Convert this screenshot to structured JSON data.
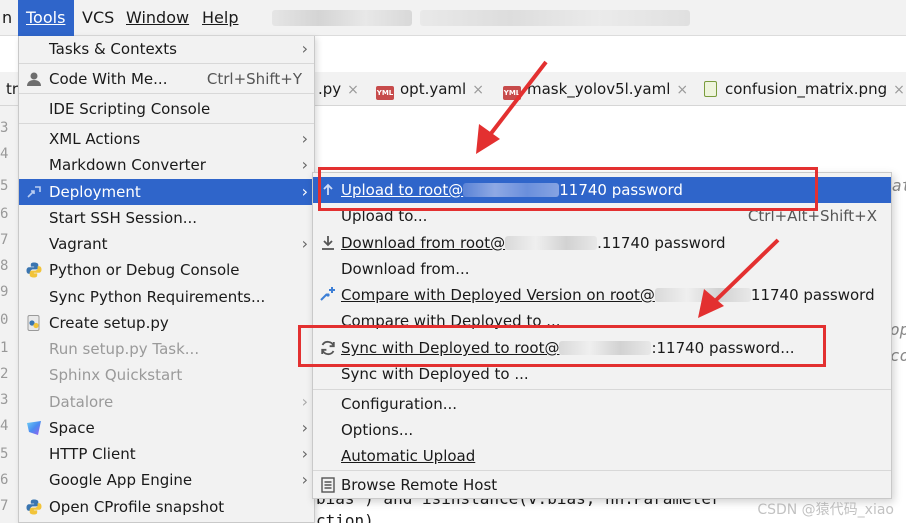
{
  "menubar": {
    "items": [
      {
        "label": "n"
      },
      {
        "label": "Tools"
      },
      {
        "label": "VCS"
      },
      {
        "label": "Window"
      },
      {
        "label": "Help"
      }
    ]
  },
  "editor": {
    "left_tab_label": "tr",
    "tabs": [
      {
        "label": ".py",
        "close": "×"
      },
      {
        "label": "opt.yaml",
        "icon": "yml-icon",
        "close": "×"
      },
      {
        "label": "mask_yolov5l.yaml",
        "icon": "yml-icon",
        "close": "×"
      },
      {
        "label": "confusion_matrix.png",
        "icon": "image-file-icon",
        "close": "×"
      }
    ],
    "gutter_numbers": [
      "3",
      "4",
      "5",
      "6",
      "7",
      "8",
      "9",
      "0",
      "1",
      "2",
      "3",
      "4",
      "5",
      "6",
      "7",
      "8"
    ],
    "code_line_bottom": [
      "bias') and isinstance(v.bias, nn.Parameter",
      "ction)"
    ],
    "side_text": [
      "at",
      "op",
      "co"
    ]
  },
  "tools_menu": {
    "items": [
      {
        "label": "Tasks & Contexts",
        "submenu": true
      },
      {
        "label": "Code With Me...",
        "shortcut": "Ctrl+Shift+Y",
        "icon": "user-icon"
      },
      {
        "label": "IDE Scripting Console"
      },
      {
        "label": "XML Actions",
        "submenu": true
      },
      {
        "label": "Markdown Converter",
        "submenu": true
      },
      {
        "label": "Deployment",
        "submenu": true,
        "selected": true,
        "icon": "deployment-icon"
      },
      {
        "label": "Start SSH Session..."
      },
      {
        "label": "Vagrant",
        "submenu": true
      },
      {
        "label": "Python or Debug Console",
        "icon": "python-icon"
      },
      {
        "label": "Sync Python Requirements..."
      },
      {
        "label": "Create setup.py",
        "icon": "python-file-icon"
      },
      {
        "label": "Run setup.py Task...",
        "disabled": true
      },
      {
        "label": "Sphinx Quickstart",
        "disabled": true
      },
      {
        "label": "Datalore",
        "submenu": true,
        "disabled": true
      },
      {
        "label": "Space",
        "submenu": true,
        "icon": "space-icon"
      },
      {
        "label": "HTTP Client",
        "submenu": true
      },
      {
        "label": "Google App Engine",
        "submenu": true
      },
      {
        "label": "Open CProfile snapshot",
        "icon": "cprofile-icon"
      }
    ]
  },
  "deployment_menu": {
    "items": [
      {
        "prefix": "Upload to root@",
        "suffix": "11740 password",
        "selected": true,
        "icon": "upload-icon"
      },
      {
        "label": "Upload to...",
        "shortcut": "Ctrl+Alt+Shift+X"
      },
      {
        "prefix": "Download from root@",
        "suffix": ".11740 password",
        "icon": "download-icon"
      },
      {
        "label": "Download from..."
      },
      {
        "prefix": "Compare with Deployed Version on root@",
        "suffix": "11740 password",
        "icon": "compare-icon"
      },
      {
        "label": "Compare with Deployed to ..."
      },
      {
        "prefix": "Sync with Deployed to root@",
        "suffix": ":11740 password...",
        "icon": "sync-icon"
      },
      {
        "label": "Sync with Deployed to ..."
      },
      {
        "label": "Configuration..."
      },
      {
        "label": "Options..."
      },
      {
        "label": "Automatic Upload"
      },
      {
        "label": "Browse Remote Host",
        "icon": "browse-remote-icon"
      }
    ]
  },
  "watermark": "CSDN @猿代码_xiao",
  "colors": {
    "selection": "#2f65ca",
    "annotation": "#e33030",
    "menu_bg": "#f2f2f2"
  }
}
